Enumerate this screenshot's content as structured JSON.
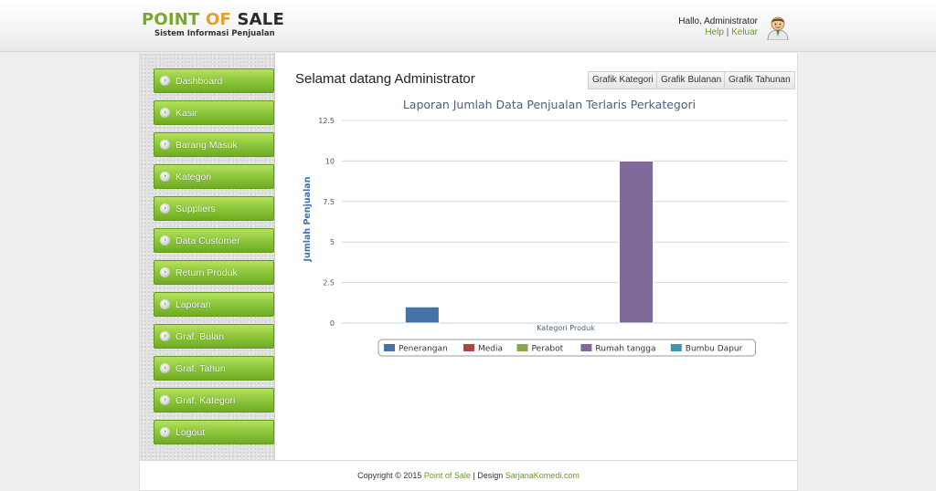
{
  "brand": {
    "title_parts": [
      "POINT",
      "OF",
      "SALE"
    ],
    "subtitle": "Sistem Informasi Penjualan"
  },
  "user": {
    "greeting": "Hallo, Administrator",
    "help_label": "Help",
    "separator": "|",
    "logout_label": "Keluar"
  },
  "sidebar": {
    "items": [
      {
        "label": "Dashboard"
      },
      {
        "label": "Kasir"
      },
      {
        "label": "Barang Masuk"
      },
      {
        "label": "Kategori"
      },
      {
        "label": "Suppliers"
      },
      {
        "label": "Data Customer"
      },
      {
        "label": "Return Produk"
      },
      {
        "label": "Laporan"
      },
      {
        "label": "Graf. Bulan"
      },
      {
        "label": "Graf. Tahun"
      },
      {
        "label": "Graf. Kategori"
      },
      {
        "label": "Logout"
      }
    ]
  },
  "main": {
    "welcome": "Selamat datang Administrator",
    "buttons": {
      "kategori": "Grafik Kategori",
      "bulanan": "Grafik Bulanan",
      "tahunan": "Grafik Tahunan"
    }
  },
  "chart_data": {
    "type": "bar",
    "title": "Laporan Jumlah Data Penjualan Terlaris Perkategori",
    "xlabel": "Kategori Produk",
    "ylabel": "Jumlah Penjualan",
    "ylim": [
      0,
      12.5
    ],
    "yticks": [
      "0",
      "2.5",
      "5",
      "7.5",
      "10",
      "12.5"
    ],
    "grid": true,
    "legend_position": "bottom",
    "series": [
      {
        "name": "Penerangan",
        "value": 1,
        "color": "#4572a7"
      },
      {
        "name": "Media",
        "value": 0,
        "color": "#aa4643"
      },
      {
        "name": "Perabot",
        "value": 0,
        "color": "#89a54e"
      },
      {
        "name": "Rumah tangga",
        "value": 10,
        "color": "#80699b"
      },
      {
        "name": "Bumbu Dapur",
        "value": 0,
        "color": "#3d96ae"
      }
    ]
  },
  "footer": {
    "copyright": "Copyright © 2015",
    "app_link": "Point of Sale",
    "design_text": "| Design",
    "designer_link": "SarjanaKomedi.com"
  }
}
